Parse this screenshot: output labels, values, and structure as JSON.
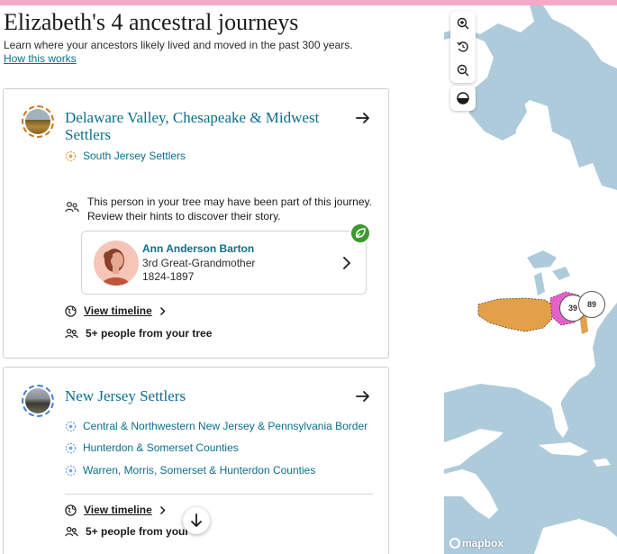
{
  "header": {
    "title": "Elizabeth's 4 ancestral journeys",
    "subtitle": "Learn where your ancestors likely lived and moved in the past 300 years.",
    "how_link": "How this works"
  },
  "journeys": [
    {
      "title": "Delaware Valley, Chesapeake & Midwest Settlers",
      "sub_journeys": [
        "South Jersey Settlers"
      ],
      "hint_text": "This person in your tree may have been part of this journey. Review their hints to discover their story.",
      "person": {
        "name": "Ann Anderson Barton",
        "relation": "3rd Great-Grandmother",
        "years": "1824-1897"
      },
      "timeline_label": "View timeline",
      "people_label": "5+ people from your tree",
      "ring_color": "#c8751a"
    },
    {
      "title": "New Jersey Settlers",
      "sub_journeys": [
        "Central & Northwestern New Jersey & Pennsylvania Border",
        "Hunterdon & Somerset Counties",
        "Warren, Morris, Somerset & Hunterdon Counties"
      ],
      "timeline_label": "View timeline",
      "people_label": "5+ people from your",
      "ring_color": "#3d7fd6"
    }
  ],
  "map": {
    "clusters": [
      "39",
      "89"
    ],
    "attribution": "mapbox",
    "water_color": "#aecbdc",
    "land_color": "#ffffff",
    "journey_color": "#e2a04a"
  },
  "colors": {
    "accent": "#0b6f8c",
    "top_strip": "#f6a9c5",
    "leaf_badge": "#3a9a2c"
  }
}
